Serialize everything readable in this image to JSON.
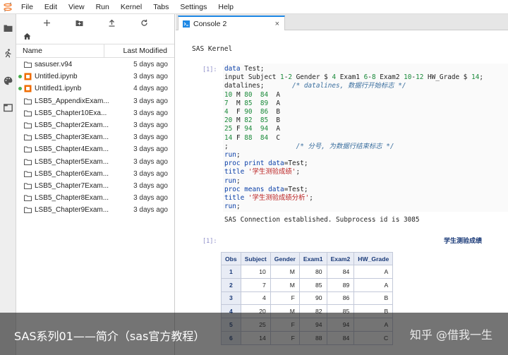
{
  "menu": [
    "File",
    "Edit",
    "View",
    "Run",
    "Kernel",
    "Tabs",
    "Settings",
    "Help"
  ],
  "filebrowser": {
    "col_name": "Name",
    "col_modified": "Last Modified",
    "files": [
      {
        "name": "sasuser.v94",
        "date": "5 days ago",
        "type": "folder",
        "running": false
      },
      {
        "name": "Untitled.ipynb",
        "date": "3 days ago",
        "type": "notebook",
        "running": true
      },
      {
        "name": "Untitled1.ipynb",
        "date": "4 days ago",
        "type": "notebook",
        "running": true
      },
      {
        "name": "LSB5_AppendixExam...",
        "date": "3 days ago",
        "type": "folder",
        "running": false
      },
      {
        "name": "LSB5_Chapter10Exa...",
        "date": "3 days ago",
        "type": "folder",
        "running": false
      },
      {
        "name": "LSB5_Chapter2Exam...",
        "date": "3 days ago",
        "type": "folder",
        "running": false
      },
      {
        "name": "LSB5_Chapter3Exam...",
        "date": "3 days ago",
        "type": "folder",
        "running": false
      },
      {
        "name": "LSB5_Chapter4Exam...",
        "date": "3 days ago",
        "type": "folder",
        "running": false
      },
      {
        "name": "LSB5_Chapter5Exam...",
        "date": "3 days ago",
        "type": "folder",
        "running": false
      },
      {
        "name": "LSB5_Chapter6Exam...",
        "date": "3 days ago",
        "type": "folder",
        "running": false
      },
      {
        "name": "LSB5_Chapter7Exam...",
        "date": "3 days ago",
        "type": "folder",
        "running": false
      },
      {
        "name": "LSB5_Chapter8Exam...",
        "date": "3 days ago",
        "type": "folder",
        "running": false
      },
      {
        "name": "LSB5_Chapter9Exam...",
        "date": "3 days ago",
        "type": "folder",
        "running": false
      }
    ]
  },
  "tab": {
    "label": "Console 2",
    "close": "×"
  },
  "console": {
    "kernel_label": "SAS Kernel",
    "prompt_in": "[1]:",
    "prompt_out": "[1]:",
    "output_text": "SAS Connection established. Subprocess id is 3085",
    "table_title": "学生测验成绩",
    "table_headers": [
      "Obs",
      "Subject",
      "Gender",
      "Exam1",
      "Exam2",
      "HW_Grade"
    ],
    "table_rows": [
      [
        "1",
        "10",
        "M",
        "80",
        "84",
        "A"
      ],
      [
        "2",
        "7",
        "M",
        "85",
        "89",
        "A"
      ],
      [
        "3",
        "4",
        "F",
        "90",
        "86",
        "B"
      ],
      [
        "4",
        "20",
        "M",
        "82",
        "85",
        "B"
      ],
      [
        "5",
        "25",
        "F",
        "94",
        "94",
        "A"
      ],
      [
        "6",
        "14",
        "F",
        "88",
        "84",
        "C"
      ]
    ]
  },
  "caption": {
    "text": "SAS系列01——简介（sas官方教程）",
    "watermark": "知乎 @借我一生"
  },
  "colors": {
    "accent": "#1e88e5",
    "running_dot": "#4caf50",
    "notebook_icon": "#ef6c00",
    "header_blue": "#1a3a78"
  }
}
